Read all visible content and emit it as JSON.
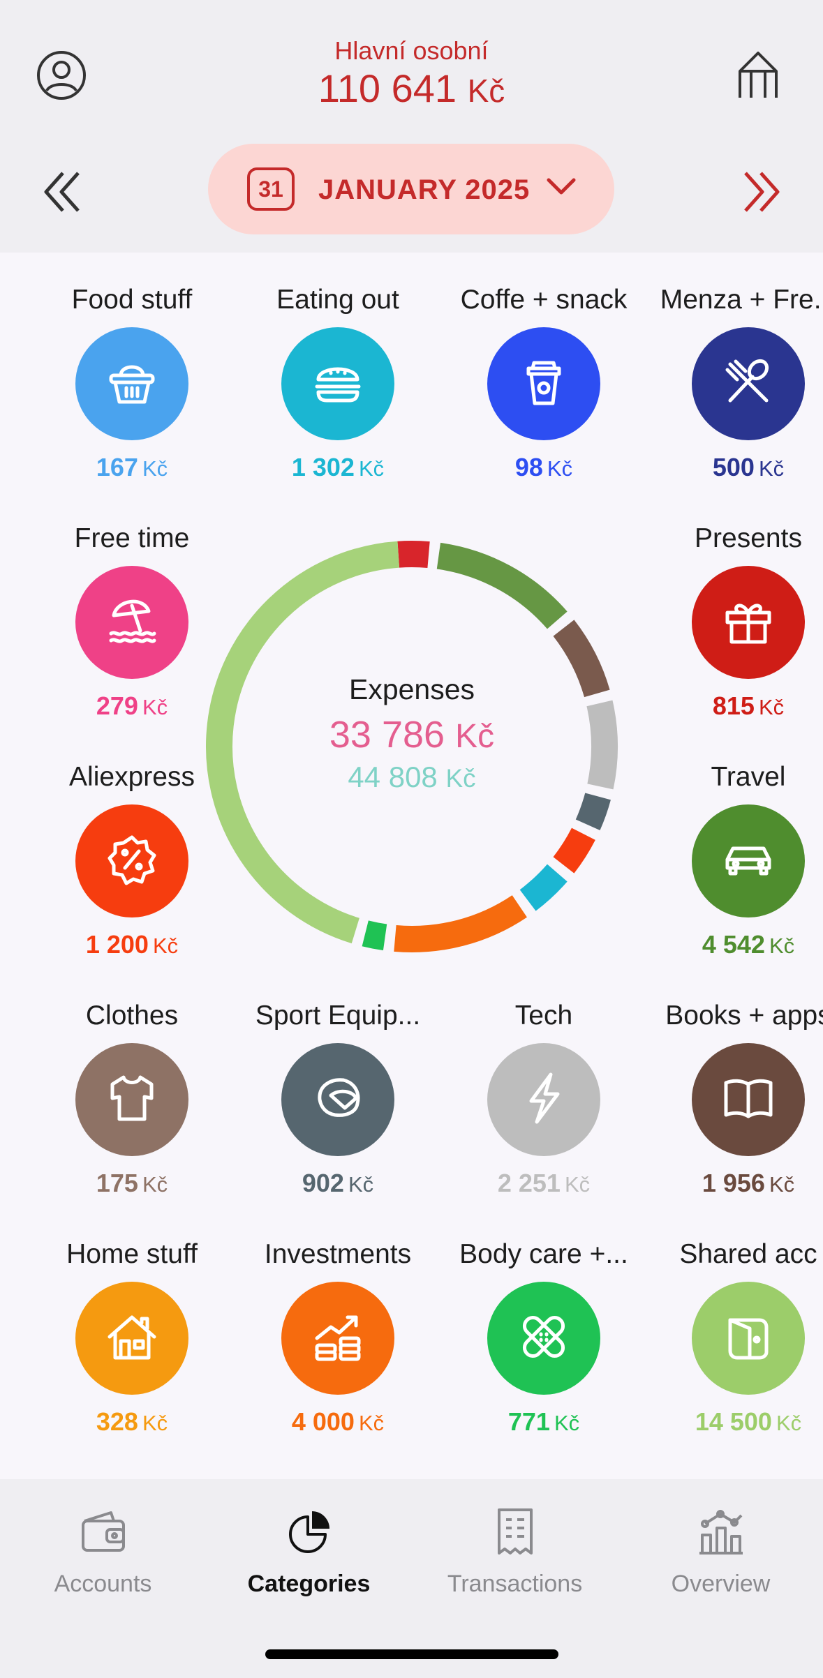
{
  "header": {
    "account_name": "Hlavní osobní",
    "balance_value": "110 641",
    "balance_currency": "Kč",
    "month": "JANUARY 2025",
    "calendar_day": "31"
  },
  "center": {
    "title": "Expenses",
    "expenses_value": "33 786",
    "expenses_currency": "Kč",
    "secondary_value": "44 808",
    "secondary_currency": "Kč"
  },
  "categories": [
    {
      "label": "Food stuff",
      "amount": "167",
      "currency": "Kč",
      "color": "#4aa3ee",
      "icon": "basket-icon"
    },
    {
      "label": "Eating out",
      "amount": "1 302",
      "currency": "Kč",
      "color": "#1bb6d2",
      "icon": "burger-icon"
    },
    {
      "label": "Coffe + snack",
      "amount": "98",
      "currency": "Kč",
      "color": "#2d4ef2",
      "icon": "coffee-cup-icon"
    },
    {
      "label": "Menza + Fre...",
      "amount": "500",
      "currency": "Kč",
      "color": "#2a3590",
      "icon": "fork-spoon-icon"
    },
    {
      "label": "Free time",
      "amount": "279",
      "currency": "Kč",
      "color": "#ef4187",
      "icon": "beach-umbrella-icon"
    },
    {
      "label": "Presents",
      "amount": "815",
      "currency": "Kč",
      "color": "#cf1d16",
      "icon": "gift-icon"
    },
    {
      "label": "Aliexpress",
      "amount": "1 200",
      "currency": "Kč",
      "color": "#f63d0f",
      "icon": "percent-badge-icon"
    },
    {
      "label": "Travel",
      "amount": "4 542",
      "currency": "Kč",
      "color": "#4f8d2e",
      "icon": "car-icon"
    },
    {
      "label": "Clothes",
      "amount": "175",
      "currency": "Kč",
      "color": "#8e7265",
      "icon": "tshirt-icon"
    },
    {
      "label": "Sport Equip...",
      "amount": "902",
      "currency": "Kč",
      "color": "#56666f",
      "icon": "helmet-icon"
    },
    {
      "label": "Tech",
      "amount": "2 251",
      "currency": "Kč",
      "color": "#bdbdbd",
      "icon": "lightning-icon"
    },
    {
      "label": "Books + apps",
      "amount": "1 956",
      "currency": "Kč",
      "color": "#6a4a3e",
      "icon": "book-icon"
    },
    {
      "label": "Home stuff",
      "amount": "328",
      "currency": "Kč",
      "color": "#f59a10",
      "icon": "house-icon"
    },
    {
      "label": "Investments",
      "amount": "4 000",
      "currency": "Kč",
      "color": "#f66b0e",
      "icon": "investment-icon"
    },
    {
      "label": "Body care +...",
      "amount": "771",
      "currency": "Kč",
      "color": "#1fc254",
      "icon": "bandage-icon"
    },
    {
      "label": "Shared acc",
      "amount": "14 500",
      "currency": "Kč",
      "color": "#9ccd6a",
      "icon": "wallet-icon"
    }
  ],
  "tabs": [
    {
      "label": "Accounts",
      "icon": "wallet-tab-icon"
    },
    {
      "label": "Categories",
      "icon": "pie-chart-icon"
    },
    {
      "label": "Transactions",
      "icon": "receipt-icon"
    },
    {
      "label": "Overview",
      "icon": "bar-chart-icon"
    }
  ]
}
